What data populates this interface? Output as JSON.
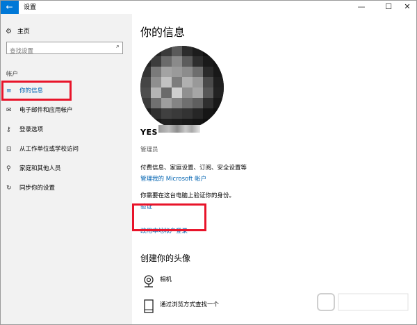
{
  "window": {
    "title": "设置",
    "back_glyph": "←",
    "controls": {
      "minimize": "—",
      "maximize": "☐",
      "close": "✕"
    }
  },
  "sidebar": {
    "home_label": "主页",
    "search_placeholder": "查找设置",
    "section_label": "帐户",
    "items": [
      {
        "label": "你的信息",
        "icon": "person-card-icon",
        "active": true
      },
      {
        "label": "电子邮件和应用帐户",
        "icon": "mail-icon",
        "active": false
      },
      {
        "label": "登录选项",
        "icon": "key-icon",
        "active": false
      },
      {
        "label": "从工作单位或学校访问",
        "icon": "briefcase-icon",
        "active": false
      },
      {
        "label": "家庭和其他人员",
        "icon": "person-icon",
        "active": false
      },
      {
        "label": "同步你的设置",
        "icon": "sync-icon",
        "active": false
      }
    ]
  },
  "main": {
    "title": "你的信息",
    "username_visible": "YES",
    "role": "管理员",
    "billing_text": "付费信息、家庭设置、订阅、安全设置等",
    "manage_link": "管理我的 Microsoft 帐户",
    "verify_text": "你需要在这台电脑上验证你的身份。",
    "verify_link": "验证",
    "local_link": "改用本地帐户登录",
    "create_avatar_title": "创建你的头像",
    "options": [
      {
        "label": "相机",
        "icon": "camera-icon"
      },
      {
        "label": "通过浏览方式查找一个",
        "icon": "browse-file-icon"
      }
    ]
  },
  "colors": {
    "accent": "#0078d7",
    "link": "#0063b1",
    "highlight_box": "#e8142a",
    "sidebar_bg": "#f2f2f2"
  }
}
